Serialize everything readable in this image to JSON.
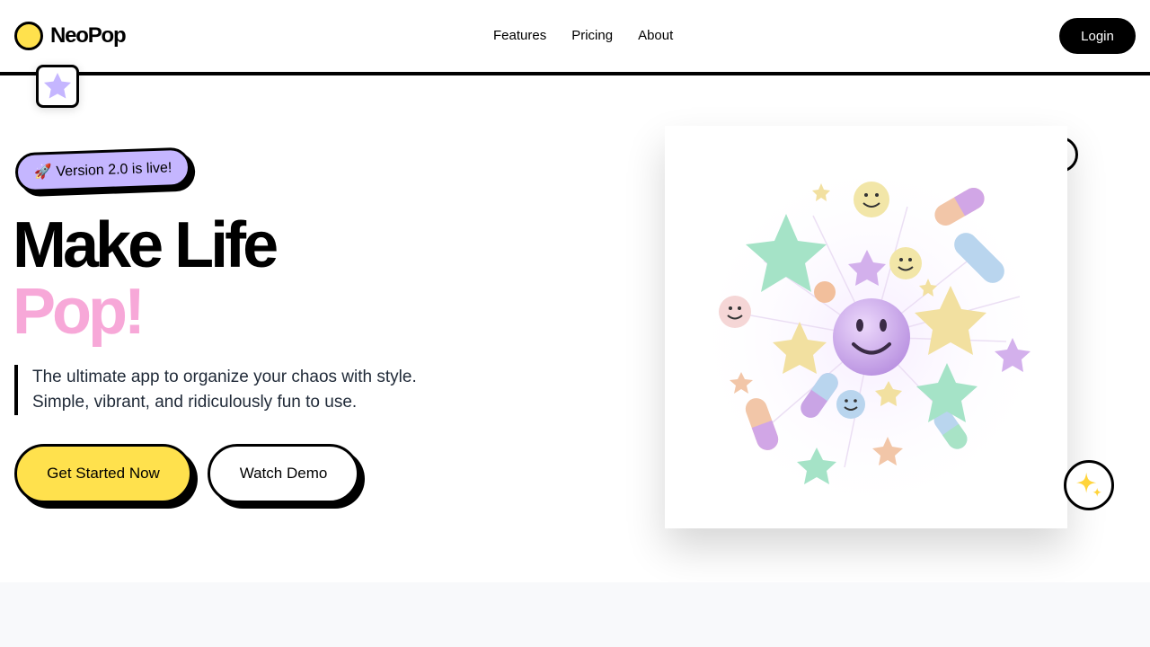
{
  "brand": {
    "name": "NeoPop",
    "logo_color": "#ffe14d"
  },
  "nav": {
    "links": [
      "Features",
      "Pricing",
      "About"
    ],
    "login_label": "Login"
  },
  "hero": {
    "badge": "🚀 Version 2.0 is live!",
    "headline_line1": "Make Life",
    "headline_line2": "Pop!",
    "subtext_line1": "The ultimate app to organize your chaos with style.",
    "subtext_line2": "Simple, vibrant, and ridiculously fun to use.",
    "primary_cta": "Get Started Now",
    "secondary_cta": "Watch Demo",
    "illustration": "3d-pastel-stars-smileys-pills"
  },
  "colors": {
    "accent_yellow": "#ffe14d",
    "accent_pink": "#f7a8d8",
    "accent_lavender": "#c5b6ff",
    "ink": "#000000",
    "muted_bg": "#f8f9fb"
  },
  "icons": {
    "float_card": "star-icon",
    "floating_button": "sparkle-icon"
  }
}
